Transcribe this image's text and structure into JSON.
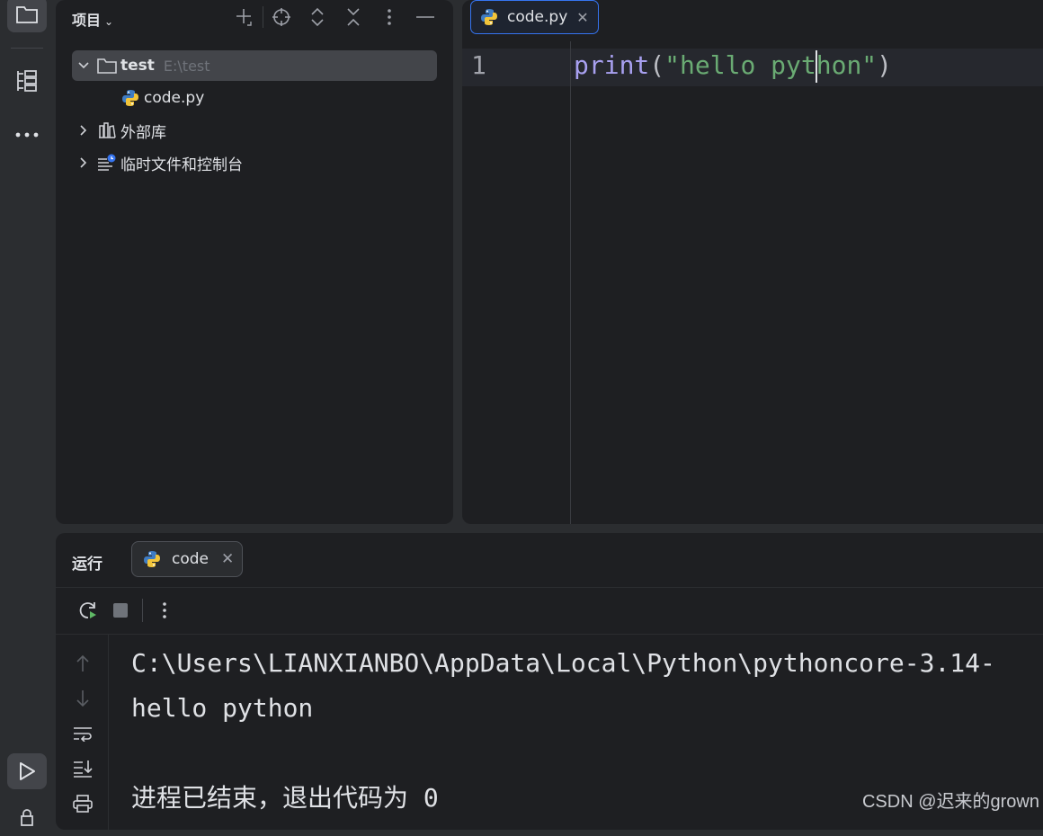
{
  "left_stripe": {
    "items": [
      {
        "name": "project-tool",
        "icon": "folder-icon"
      },
      {
        "name": "structure-tool",
        "icon": "structure-icon"
      },
      {
        "name": "more-tools",
        "icon": "more-horizontal-icon"
      },
      {
        "name": "run-tool",
        "icon": "run-icon"
      }
    ]
  },
  "project_panel": {
    "title": "项目",
    "tree": [
      {
        "label": "test",
        "path": "E:\\test",
        "expanded": true,
        "icon": "folder-icon"
      },
      {
        "label": "code.py",
        "icon": "python-file-icon"
      },
      {
        "label": "外部库",
        "expanded": false,
        "icon": "library-icon"
      },
      {
        "label": "临时文件和控制台",
        "expanded": false,
        "icon": "scratches-icon"
      }
    ]
  },
  "editor": {
    "tab_label": "code.py",
    "line_number": "1",
    "code": {
      "func": "print",
      "open": "(",
      "string": "\"hello python\"",
      "close": ")"
    }
  },
  "run_panel": {
    "title": "运行",
    "tab_label": "code",
    "console_lines": [
      "C:\\Users\\LIANXIANBO\\AppData\\Local\\Python\\pythoncore-3.14-",
      "hello python",
      "",
      "进程已结束，退出代码为 0"
    ]
  },
  "watermark": "CSDN @迟来的grown",
  "colors": {
    "accent": "#3574f0",
    "keyword": "#a8a0f0",
    "string": "#6aab73",
    "panel": "#1e1f22",
    "frame": "#2b2d30"
  }
}
